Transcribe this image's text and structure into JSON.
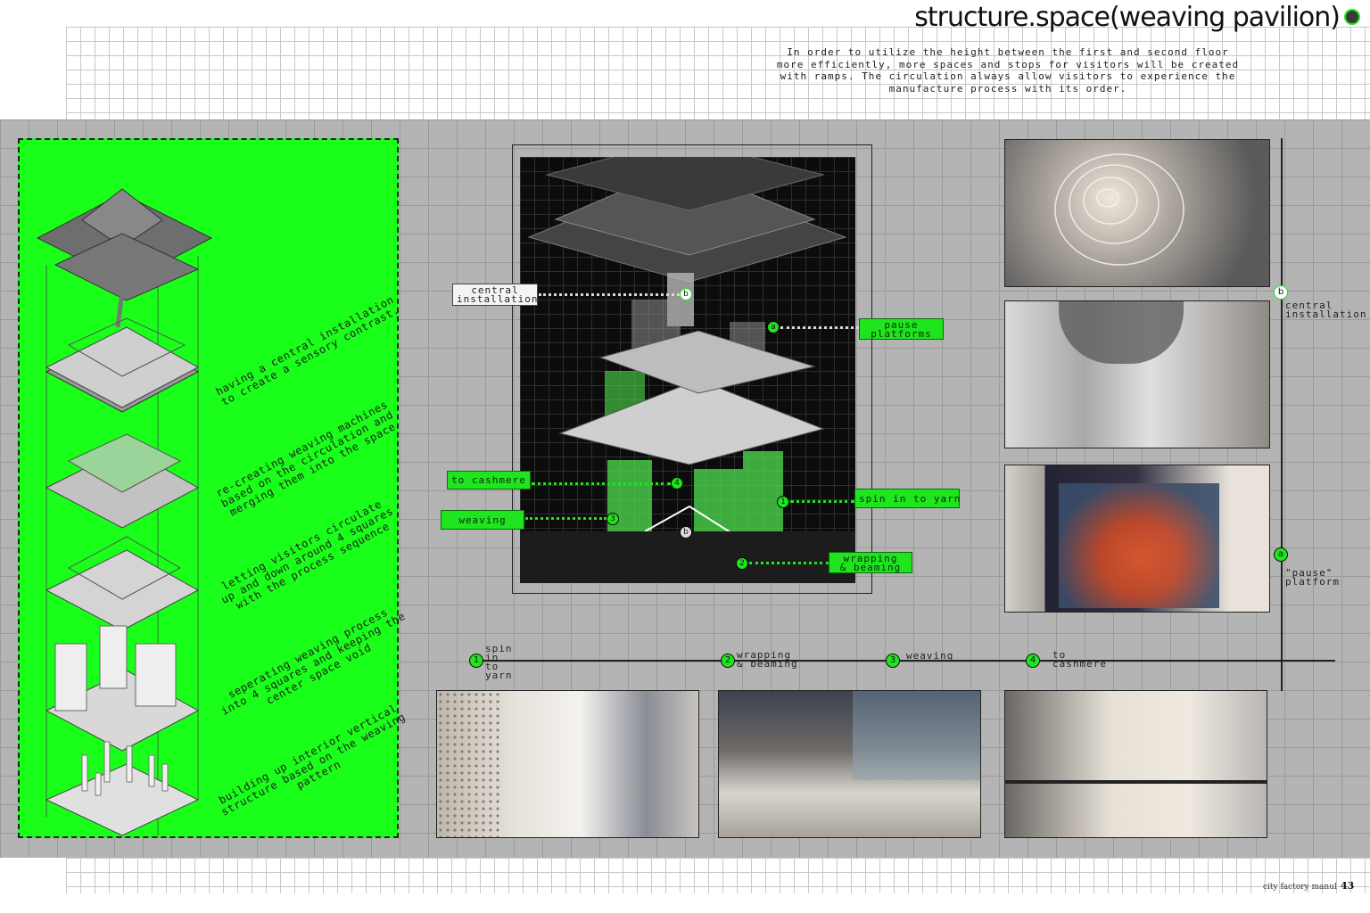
{
  "title": "structure.space(weaving pavilion)",
  "intro": "In order to utilize the height between the first and second floor\nmore efficiently, more spaces and stops for visitors will be created\nwith ramps. The circulation always allow visitors to experience the\nmanufacture process with its order.",
  "steps": [
    "having a central installation\nto create a sensory contrast.",
    "re-creating weaving machines\nbased on the circulation and\nmerging them into the space",
    "letting visitors circulate\nup and down around 4 squares\nwith the process sequence",
    "seperating weaving process\ninto 4 squares and keeping the\ncenter space void",
    "building up interior vertical\nstructure based on the weaving\npattern"
  ],
  "axo_labels": {
    "central_installation": "central\ninstallation",
    "pause_platforms": "pause\nplatforms",
    "to_cashmere": "to cashmere",
    "weaving": "weaving",
    "spin_in_to_yarn": "spin in to yarn",
    "wrapping_beaming": "wrapping\n& beaming"
  },
  "markers": {
    "a": "a",
    "b": "b",
    "n1": "1",
    "n2": "2",
    "n3": "3",
    "n4": "4"
  },
  "side_labels": {
    "central_installation": "central\ninstallation",
    "pause_platform": "\"pause\"\nplatform"
  },
  "timeline": [
    {
      "num": "1",
      "label": "spin\nin\nto\nyarn"
    },
    {
      "num": "2",
      "label": "wrapping\n& beaming"
    },
    {
      "num": "3",
      "label": "weaving"
    },
    {
      "num": "4",
      "label": "to\ncashmere"
    }
  ],
  "footer": {
    "text": "city factory manul",
    "page": "43"
  },
  "colors": {
    "accent": "#1ee51e",
    "panel": "#19ff19",
    "band": "#b4b4b4"
  }
}
